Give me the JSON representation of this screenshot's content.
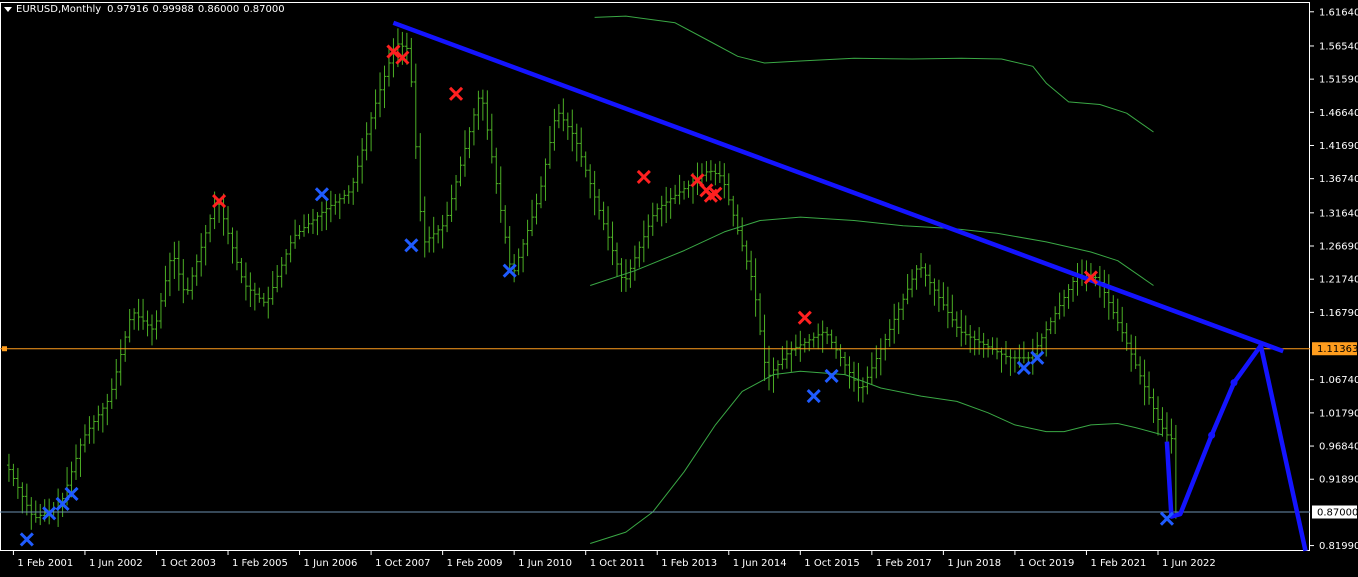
{
  "header": {
    "symbol": "EURUSD,Monthly",
    "open": "0.97916",
    "high": "0.99988",
    "low": "0.86000",
    "close": "0.87000"
  },
  "colors": {
    "background": "#000000",
    "frame": "#ffffff",
    "bars": "#4caf25",
    "envelope": "#3aa845",
    "trendline": "#1414ff",
    "projection": "#1414ff",
    "cross_red": "#ff2020",
    "cross_blue": "#1f5bff",
    "hline_orange": "#ff9d1e",
    "hline_blue": "#6b8fb0",
    "price_label_orange": "#ff9d1e",
    "price_label_white": "#ffffff"
  },
  "chart_data": {
    "type": "ohlc",
    "symbol": "EURUSD",
    "timeframe": "Monthly",
    "y_ticks": [
      "1.61640",
      "1.56540",
      "1.51590",
      "1.46640",
      "1.41690",
      "1.36740",
      "1.31640",
      "1.26690",
      "1.21740",
      "1.16790",
      "1.06740",
      "1.01790",
      "0.96840",
      "0.91890",
      "0.81990"
    ],
    "x_ticks": [
      "1 Feb 2001",
      "1 Jun 2002",
      "1 Oct 2003",
      "1 Feb 2005",
      "1 Jun 2006",
      "1 Oct 2007",
      "1 Feb 2009",
      "1 Jun 2010",
      "1 Oct 2011",
      "1 Feb 2013",
      "1 Jun 2014",
      "1 Oct 2015",
      "1 Feb 2017",
      "1 Jun 2018",
      "1 Oct 2019",
      "1 Feb 2021",
      "1 Jun 2022"
    ],
    "ylim": [
      0.8118,
      1.631
    ],
    "xlim": [
      "Nov 2000",
      "Apr 2025"
    ],
    "grid": false,
    "price_path": [
      [
        "2001-01",
        0.94
      ],
      [
        "2001-07",
        0.86
      ],
      [
        "2002-01",
        0.88
      ],
      [
        "2002-06",
        0.98
      ],
      [
        "2002-12",
        1.04
      ],
      [
        "2003-05",
        1.17
      ],
      [
        "2003-10",
        1.14
      ],
      [
        "2004-02",
        1.26
      ],
      [
        "2004-05",
        1.19
      ],
      [
        "2004-12",
        1.34
      ],
      [
        "2005-06",
        1.21
      ],
      [
        "2005-11",
        1.18
      ],
      [
        "2006-05",
        1.28
      ],
      [
        "2006-12",
        1.32
      ],
      [
        "2007-06",
        1.35
      ],
      [
        "2007-11",
        1.47
      ],
      [
        "2008-04",
        1.57
      ],
      [
        "2008-07",
        1.56
      ],
      [
        "2008-10",
        1.27
      ],
      [
        "2009-03",
        1.3
      ],
      [
        "2009-11",
        1.5
      ],
      [
        "2010-06",
        1.22
      ],
      [
        "2010-12",
        1.34
      ],
      [
        "2011-04",
        1.47
      ],
      [
        "2011-08",
        1.43
      ],
      [
        "2012-07",
        1.21
      ],
      [
        "2013-02",
        1.32
      ],
      [
        "2014-02",
        1.38
      ],
      [
        "2014-05",
        1.37
      ],
      [
        "2014-12",
        1.21
      ],
      [
        "2015-03",
        1.07
      ],
      [
        "2015-08",
        1.11
      ],
      [
        "2016-04",
        1.14
      ],
      [
        "2016-12",
        1.05
      ],
      [
        "2017-05",
        1.12
      ],
      [
        "2018-01",
        1.24
      ],
      [
        "2018-10",
        1.14
      ],
      [
        "2019-09",
        1.1
      ],
      [
        "2020-02",
        1.1
      ],
      [
        "2020-12",
        1.22
      ],
      [
        "2021-05",
        1.22
      ],
      [
        "2021-11",
        1.13
      ],
      [
        "2022-07",
        1.0
      ],
      [
        "2022-09",
        0.98
      ],
      [
        "2022-10",
        0.97916
      ]
    ],
    "envelope_upper": [
      [
        "2011-12",
        1.608
      ],
      [
        "2012-07",
        1.61
      ],
      [
        "2013-06",
        1.6
      ],
      [
        "2014-01",
        1.575
      ],
      [
        "2014-08",
        1.55
      ],
      [
        "2015-02",
        1.54
      ],
      [
        "2015-10",
        1.543
      ],
      [
        "2016-10",
        1.547
      ],
      [
        "2017-11",
        1.546
      ],
      [
        "2018-10",
        1.547
      ],
      [
        "2019-07",
        1.546
      ],
      [
        "2020-02",
        1.535
      ],
      [
        "2020-05",
        1.51
      ],
      [
        "2020-10",
        1.482
      ],
      [
        "2021-05",
        1.478
      ],
      [
        "2021-11",
        1.465
      ],
      [
        "2022-05",
        1.437
      ]
    ],
    "envelope_middle": [
      [
        "2011-11",
        1.208
      ],
      [
        "2012-09",
        1.23
      ],
      [
        "2013-08",
        1.26
      ],
      [
        "2014-05",
        1.288
      ],
      [
        "2015-01",
        1.305
      ],
      [
        "2015-10",
        1.31
      ],
      [
        "2016-10",
        1.305
      ],
      [
        "2017-09",
        1.297
      ],
      [
        "2018-08",
        1.293
      ],
      [
        "2019-06",
        1.286
      ],
      [
        "2020-05",
        1.273
      ],
      [
        "2021-03",
        1.258
      ],
      [
        "2021-09",
        1.245
      ],
      [
        "2022-05",
        1.208
      ]
    ],
    "envelope_lower": [
      [
        "2011-11",
        0.823
      ],
      [
        "2012-07",
        0.84
      ],
      [
        "2013-01",
        0.87
      ],
      [
        "2013-08",
        0.93
      ],
      [
        "2014-03",
        1.0
      ],
      [
        "2014-09",
        1.05
      ],
      [
        "2015-04",
        1.075
      ],
      [
        "2015-10",
        1.08
      ],
      [
        "2016-08",
        1.075
      ],
      [
        "2017-04",
        1.055
      ],
      [
        "2018-01",
        1.043
      ],
      [
        "2018-09",
        1.035
      ],
      [
        "2019-04",
        1.018
      ],
      [
        "2019-10",
        1.0
      ],
      [
        "2020-05",
        0.99
      ],
      [
        "2020-09",
        0.99
      ],
      [
        "2021-03",
        1.0
      ],
      [
        "2021-09",
        1.002
      ],
      [
        "2022-01",
        0.996
      ],
      [
        "2022-07",
        0.985
      ]
    ],
    "trendline": [
      [
        "2008-03",
        1.6
      ],
      [
        "2024-10",
        1.11
      ]
    ],
    "projection": [
      [
        "2022-08",
        0.975
      ],
      [
        "2022-09",
        0.8632
      ],
      [
        "2022-11",
        0.8668
      ],
      [
        "2023-06",
        0.9845
      ],
      [
        "2023-11",
        1.063
      ],
      [
        "2024-05",
        1.1183
      ],
      [
        "2025-03",
        0.812
      ]
    ],
    "markers_red": [
      [
        "2004-12",
        1.334
      ],
      [
        "2008-03",
        1.557
      ],
      [
        "2008-05",
        1.548
      ],
      [
        "2009-05",
        1.494
      ],
      [
        "2012-11",
        1.37
      ],
      [
        "2013-11",
        1.365
      ],
      [
        "2014-01",
        1.35
      ],
      [
        "2014-02",
        1.342
      ],
      [
        "2014-03",
        1.345
      ],
      [
        "2015-11",
        1.16
      ],
      [
        "2021-03",
        1.22
      ]
    ],
    "markers_blue": [
      [
        "2001-05",
        0.829
      ],
      [
        "2001-10",
        0.868
      ],
      [
        "2002-01",
        0.882
      ],
      [
        "2002-03",
        0.897
      ],
      [
        "2006-11",
        1.344
      ],
      [
        "2008-07",
        1.268
      ],
      [
        "2010-05",
        1.23
      ],
      [
        "2016-01",
        1.043
      ],
      [
        "2016-05",
        1.073
      ],
      [
        "2019-12",
        1.085
      ],
      [
        "2020-03",
        1.1
      ],
      [
        "2022-08",
        0.86
      ]
    ],
    "hlines": [
      {
        "price": 1.11363,
        "label": "1.11363",
        "color": "orange"
      },
      {
        "price": 0.87,
        "label": "0.87000",
        "color": "white"
      }
    ]
  }
}
